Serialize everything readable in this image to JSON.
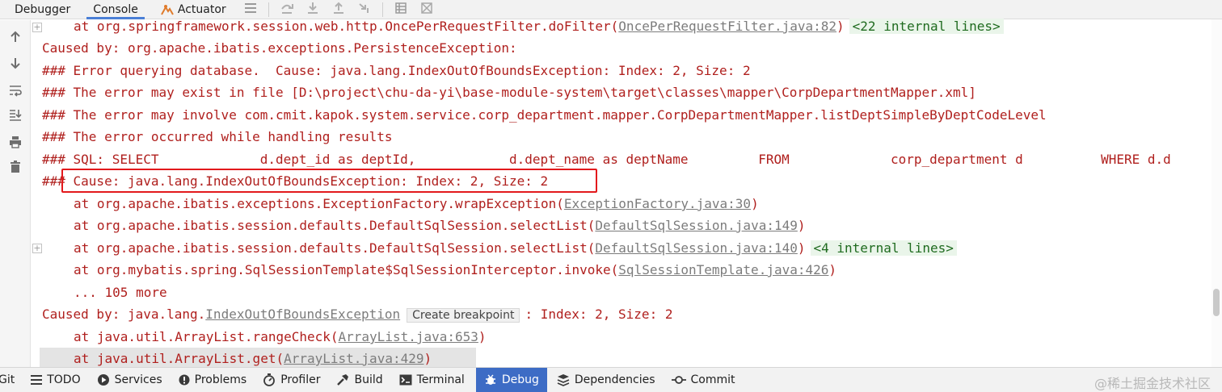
{
  "toolbar": {
    "tabs": [
      {
        "label": "Debugger",
        "icon": "none"
      },
      {
        "label": "Console",
        "icon": "none",
        "active": true
      },
      {
        "label": "Actuator",
        "icon": "actuator-icon"
      }
    ]
  },
  "console": {
    "lines": [
      {
        "prefix": "at org.springframework.session.web.http.OncePerRequestFilter.doFilter(",
        "link": "OncePerRequestFilter.java:82",
        "suffix": ")",
        "hint": "<22 internal lines>"
      },
      {
        "text": "Caused by: org.apache.ibatis.exceptions.PersistenceException:"
      },
      {
        "text": "### Error querying database.  Cause: java.lang.IndexOutOfBoundsException: Index: 2, Size: 2"
      },
      {
        "text": "### The error may exist in file [D:\\project\\chu-da-yi\\base-module-system\\target\\classes\\mapper\\CorpDepartmentMapper.xml]"
      },
      {
        "text": "### The error may involve com.cmit.kapok.system.service.corp_department.mapper.CorpDepartmentMapper.listDeptSimpleByDeptCodeLevel"
      },
      {
        "text": "### The error occurred while handling results"
      },
      {
        "text": "### SQL: SELECT             d.dept_id as deptId,            d.dept_name as deptName         FROM             corp_department d          WHERE d.d"
      },
      {
        "text": "### Cause: java.lang.IndexOutOfBoundsException: Index: 2, Size: 2"
      },
      {
        "prefix": "at org.apache.ibatis.exceptions.ExceptionFactory.wrapException(",
        "link": "ExceptionFactory.java:30",
        "suffix": ")"
      },
      {
        "prefix": "at org.apache.ibatis.session.defaults.DefaultSqlSession.selectList(",
        "link": "DefaultSqlSession.java:149",
        "suffix": ")"
      },
      {
        "prefix": "at org.apache.ibatis.session.defaults.DefaultSqlSession.selectList(",
        "link": "DefaultSqlSession.java:140",
        "suffix": ")",
        "hint": "<4 internal lines>"
      },
      {
        "prefix": "at org.mybatis.spring.SqlSessionTemplate$SqlSessionInterceptor.invoke(",
        "link": "SqlSessionTemplate.java:426",
        "suffix": ")"
      },
      {
        "text": "... 105 more"
      },
      {
        "prefix": "Caused by: java.lang.",
        "link": "IndexOutOfBoundsException",
        "tooltip": "Create breakpoint",
        "suffix": ": Index: 2, Size: 2"
      },
      {
        "prefix": "at java.util.ArrayList.rangeCheck(",
        "link": "ArrayList.java:653",
        "suffix": ")"
      },
      {
        "prefix": "at java.util.ArrayList.get(",
        "link": "ArrayList.java:429",
        "suffix": ")"
      }
    ]
  },
  "bottombar": {
    "items": [
      {
        "label": "Git",
        "icon": "none"
      },
      {
        "label": "TODO",
        "icon": "list-icon"
      },
      {
        "label": "Services",
        "icon": "services-icon"
      },
      {
        "label": "Problems",
        "icon": "problems-icon"
      },
      {
        "label": "Profiler",
        "icon": "profiler-icon"
      },
      {
        "label": "Build",
        "icon": "build-icon"
      },
      {
        "label": "Terminal",
        "icon": "terminal-icon"
      },
      {
        "label": "Debug",
        "icon": "debug-icon",
        "active": true
      },
      {
        "label": "Dependencies",
        "icon": "dependencies-icon"
      },
      {
        "label": "Commit",
        "icon": "commit-icon"
      }
    ],
    "watermark": "@稀土掘金技术社区"
  },
  "colors": {
    "error_text": "#b0201e",
    "link": "#7c7c7c",
    "hint": "#1f6b1f",
    "highlight_box": "#e3191c",
    "active_tab": "#3d6cc5"
  }
}
